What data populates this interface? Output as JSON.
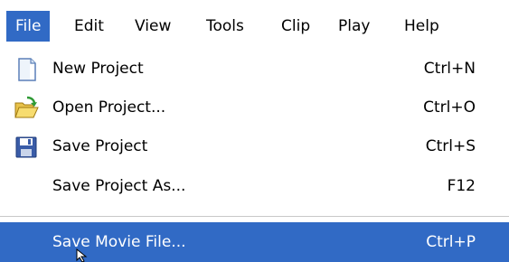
{
  "menubar": {
    "items": [
      {
        "label": "File"
      },
      {
        "label": "Edit"
      },
      {
        "label": "View"
      },
      {
        "label": "Tools"
      },
      {
        "label": "Clip"
      },
      {
        "label": "Play"
      },
      {
        "label": "Help"
      }
    ],
    "active_index": 0
  },
  "file_menu": {
    "items": [
      {
        "label": "New Project",
        "shortcut": "Ctrl+N",
        "icon": "new-document-icon"
      },
      {
        "label": "Open Project...",
        "shortcut": "Ctrl+O",
        "icon": "open-folder-icon"
      },
      {
        "label": "Save Project",
        "shortcut": "Ctrl+S",
        "icon": "floppy-disk-icon"
      },
      {
        "label": "Save Project As...",
        "shortcut": "F12",
        "icon": ""
      },
      {
        "label": "Save Movie File...",
        "shortcut": "Ctrl+P",
        "icon": "",
        "highlighted": true
      }
    ]
  },
  "colors": {
    "highlight": "#316ac5",
    "highlight_text": "#ffffff",
    "text": "#000000",
    "background": "#ffffff"
  }
}
